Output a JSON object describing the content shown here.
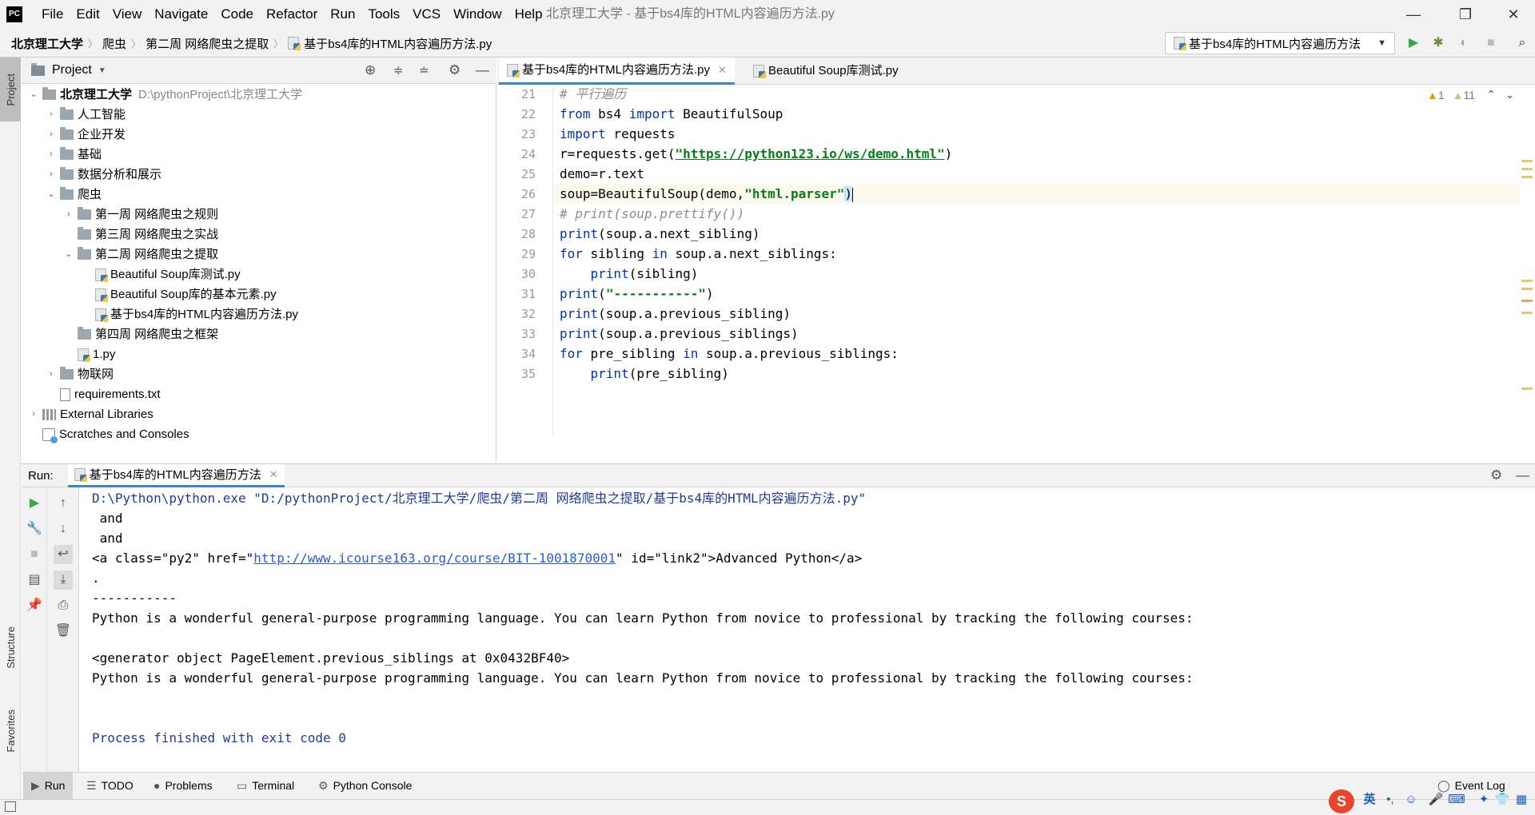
{
  "window": {
    "title": "北京理工大学 - 基于bs4库的HTML内容遍历方法.py",
    "menu": [
      "File",
      "Edit",
      "View",
      "Navigate",
      "Code",
      "Refactor",
      "Run",
      "Tools",
      "VCS",
      "Window",
      "Help"
    ],
    "controls": {
      "minimize": "—",
      "restore": "❐",
      "close": "✕"
    }
  },
  "breadcrumb": [
    "北京理工大学",
    "爬虫",
    "第二周 网络爬虫之提取",
    "基于bs4库的HTML内容遍历方法.py"
  ],
  "toolbar": {
    "run_config": "基于bs4库的HTML内容遍历方法",
    "icons": [
      "run-icon",
      "debug-icon",
      "coverage-icon",
      "stop-icon",
      "search-icon"
    ]
  },
  "left_strip": {
    "project": "Project",
    "structure": "Structure",
    "favorites": "Favorites"
  },
  "project": {
    "header": "Project",
    "root": {
      "name": "北京理工大学",
      "path": "D:\\pythonProject\\北京理工大学"
    },
    "items": [
      {
        "label": "人工智能"
      },
      {
        "label": "企业开发"
      },
      {
        "label": "基础"
      },
      {
        "label": "数据分析和展示"
      },
      {
        "label": "爬虫"
      },
      {
        "label": "第一周 网络爬虫之规则"
      },
      {
        "label": "第三周 网络爬虫之实战"
      },
      {
        "label": "第二周 网络爬虫之提取"
      },
      {
        "label": "Beautiful Soup库测试.py"
      },
      {
        "label": "Beautiful  Soup库的基本元素.py"
      },
      {
        "label": "基于bs4库的HTML内容遍历方法.py"
      },
      {
        "label": "第四周 网络爬虫之框架"
      },
      {
        "label": "1.py"
      },
      {
        "label": "物联网"
      },
      {
        "label": "requirements.txt"
      },
      {
        "label": "External Libraries"
      },
      {
        "label": "Scratches and Consoles"
      }
    ]
  },
  "editor": {
    "tabs": [
      {
        "label": "基于bs4库的HTML内容遍历方法.py",
        "active": true
      },
      {
        "label": "Beautiful Soup库测试.py",
        "active": false
      }
    ],
    "inspections": {
      "warnings": "1",
      "weak_warnings": "11"
    },
    "line_numbers": [
      "21",
      "22",
      "23",
      "24",
      "25",
      "26",
      "27",
      "28",
      "29",
      "30",
      "31",
      "32",
      "33",
      "34",
      "35"
    ],
    "lines": {
      "l21": "# 平行遍历",
      "l22a": "from",
      " l22b": "",
      "l22_rest": " bs4 ",
      "l22_import": "import",
      "l22_tail": " BeautifulSoup",
      "l23_kw": "import",
      "l23_tail": " requests",
      "l24_pre": "r=requests.get(",
      "l24_url": "\"https://python123.io/ws/demo.html\"",
      "l24_post": ")",
      "l25": "demo=r.text",
      "l26_pre": "soup=BeautifulSoup(demo,",
      "l26_str": "\"html.parser\"",
      "l26_post": ")",
      "l27": "# print(soup.prettify())",
      "l28_kw": "print",
      "l28_tail": "(soup.a.next_sibling)",
      "l29_for": "for",
      "l29_mid": " sibling ",
      "l29_in": "in",
      "l29_tail": " soup.a.next_siblings:",
      "l30_kw": "print",
      "l30_tail": "(sibling)",
      "l31_kw": "print",
      "l31_open": "(",
      "l31_str": "\"-----------\"",
      "l31_close": ")",
      "l32_kw": "print",
      "l32_tail": "(soup.a.previous_sibling)",
      "l33_kw": "print",
      "l33_tail": "(soup.a.previous_siblings)",
      "l34_for": "for",
      "l34_mid": " pre_sibling ",
      "l34_in": "in",
      "l34_tail": " soup.a.previous_siblings:",
      "l35_kw": "print",
      "l35_tail": "(pre_sibling)"
    }
  },
  "run": {
    "label": "Run:",
    "tab": "基于bs4库的HTML内容遍历方法",
    "output": {
      "cmd": "D:\\Python\\python.exe \"D:/pythonProject/北京理工大学/爬虫/第二周 网络爬虫之提取/基于bs4库的HTML内容遍历方法.py\"",
      "o1": " and",
      "o2": " and",
      "o3_pre": "<a class=\"py2\" href=\"",
      "o3_link": "http://www.icourse163.org/course/BIT-1001870001",
      "o3_post": "\" id=\"link2\">Advanced Python</a>",
      "o4": ".",
      "o5": "-----------",
      "o6": "Python is a wonderful general-purpose programming language. You can learn Python from novice to professional by tracking the following courses:",
      "o7": "<generator object PageElement.previous_siblings at 0x0432BF40>",
      "o8": "Python is a wonderful general-purpose programming language. You can learn Python from novice to professional by tracking the following courses:",
      "o9": "Process finished with exit code 0"
    }
  },
  "bottom_tabs": [
    "Run",
    "TODO",
    "Problems",
    "Terminal",
    "Python Console",
    "Event Log"
  ],
  "tray": {
    "ime": "英"
  },
  "colors": {
    "keyword": "#0033b3",
    "string": "#067d17",
    "comment": "#8c8c8c",
    "accent": "#4083c9",
    "current_line": "#fcfaed"
  }
}
